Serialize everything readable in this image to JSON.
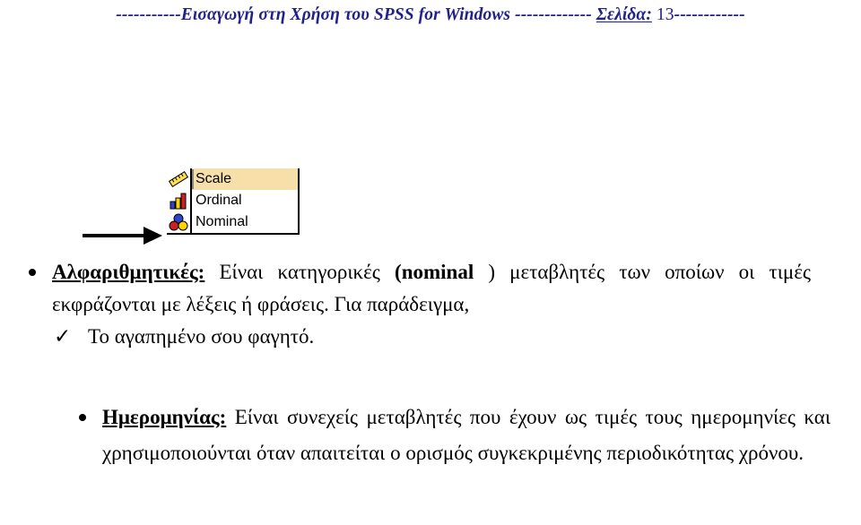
{
  "header": {
    "left_dashes": "-----------",
    "title": "Εισαγωγή στη Χρήση του SPSS for Windows",
    "mid_dashes": " ------------- ",
    "page_label": "Σελίδα:",
    "page_number": " 13",
    "right_dashes": "------------",
    "color": "#21218c"
  },
  "figure": {
    "arrow_name": "pointer-arrow",
    "measure_dropdown": {
      "options": [
        {
          "label": "Scale",
          "icon": "ruler-icon",
          "selected": true
        },
        {
          "label": "Ordinal",
          "icon": "bar-chart-icon",
          "selected": false
        },
        {
          "label": "Nominal",
          "icon": "colored-balls-icon",
          "selected": false
        }
      ],
      "selected_value": "Scale",
      "highlight_color": "#f6dfa8"
    }
  },
  "content": {
    "alphanumeric": {
      "term": "Αλφαριθμητικές:",
      "text_before_bold": " Είναι κατηγορικές ",
      "bold_term": "(nominal ",
      "text_after_bold": ") μεταβλητές των οποίων οι τιμές εκφράζονται με λέξεις ή φράσεις. Για παράδειγμα,"
    },
    "example": {
      "mark": "✓",
      "text": "Το αγαπημένο σου φαγητό."
    },
    "date": {
      "term": "Ημερομηνίας:",
      "line1": " Είναι συνεχείς μεταβλητές που έχουν ως τιμές τους",
      "line2": "ημερομηνίες και χρησιμοποιούνται όταν απαιτείται ο ορισμός",
      "line3": "συγκεκριμένης περιοδικότητας χρόνου."
    }
  }
}
